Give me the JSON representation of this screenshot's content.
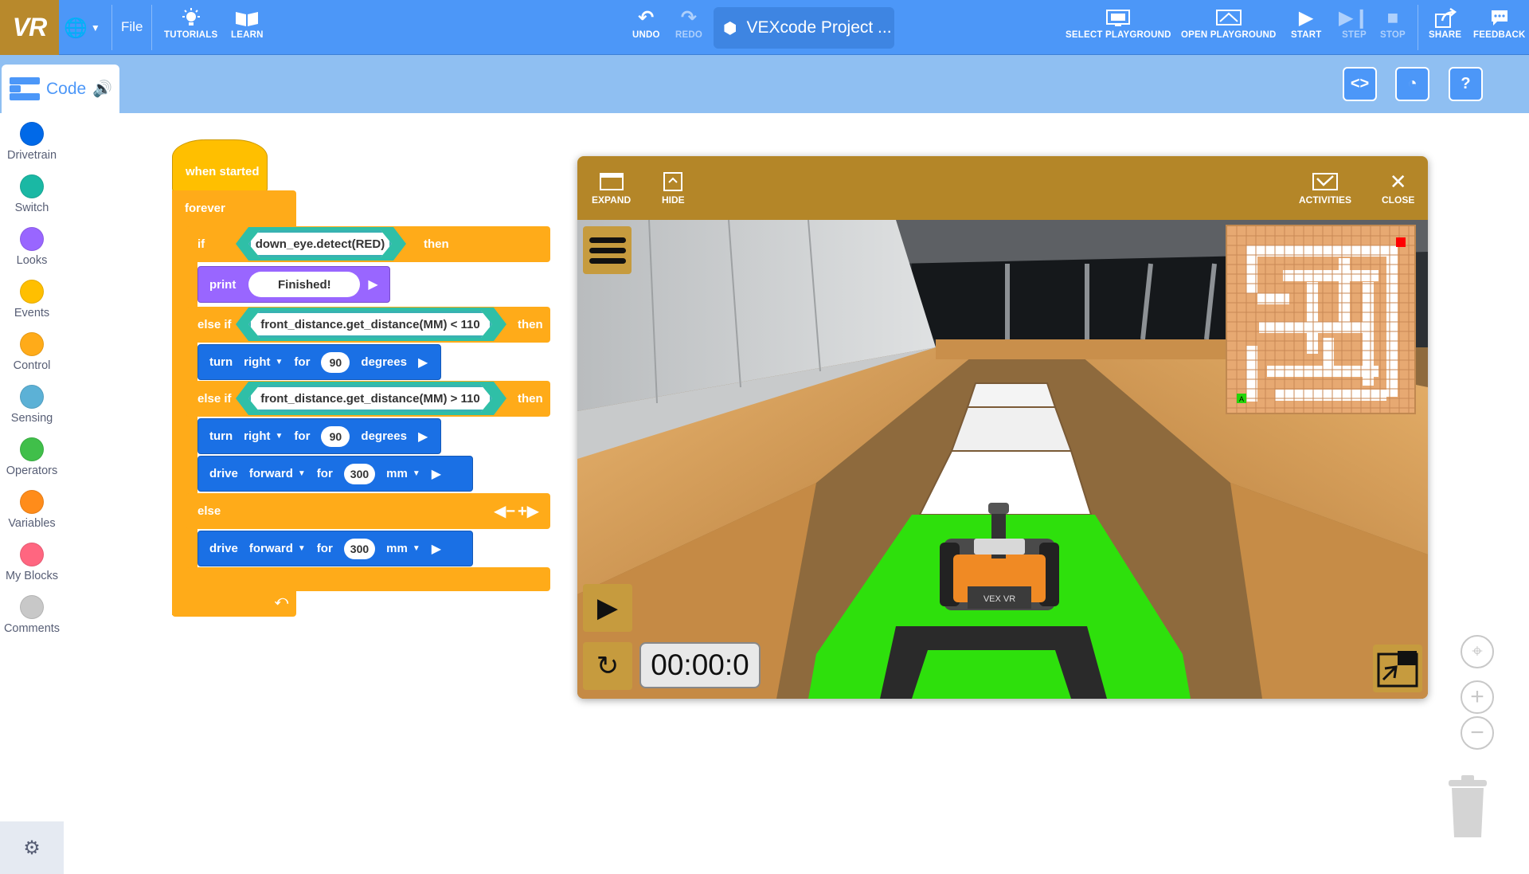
{
  "topbar": {
    "logo": "VR",
    "menu_file": "File",
    "tutorials": "TUTORIALS",
    "learn": "LEARN",
    "undo": "UNDO",
    "redo": "REDO",
    "project_name": "VEXcode Project ...",
    "select_playground": "SELECT PLAYGROUND",
    "open_playground": "OPEN PLAYGROUND",
    "start": "START",
    "step": "STEP",
    "stop": "STOP",
    "share": "SHARE",
    "feedback": "FEEDBACK"
  },
  "code_tab": {
    "label": "Code"
  },
  "categories": [
    {
      "label": "Drivetrain",
      "color": "#0069e8"
    },
    {
      "label": "Switch",
      "color": "#1ab8a4"
    },
    {
      "label": "Looks",
      "color": "#9966ff"
    },
    {
      "label": "Events",
      "color": "#ffbf00"
    },
    {
      "label": "Control",
      "color": "#ffab19"
    },
    {
      "label": "Sensing",
      "color": "#5cb1d6"
    },
    {
      "label": "Operators",
      "color": "#40bf4a"
    },
    {
      "label": "Variables",
      "color": "#ff8c1a"
    },
    {
      "label": "My Blocks",
      "color": "#ff6680"
    },
    {
      "label": "Comments",
      "color": "#c8c8c8"
    }
  ],
  "blocks": {
    "when_started": "when started",
    "forever": "forever",
    "if": "if",
    "cond1": "down_eye.detect(RED)",
    "then": "then",
    "print": "print",
    "print_text": "Finished!",
    "else_if": "else if",
    "cond2": "front_distance.get_distance(MM) < 110",
    "cond3": "front_distance.get_distance(MM) > 110",
    "turn": "turn",
    "right": "right",
    "for": "for",
    "turn_value": "90",
    "degrees": "degrees",
    "drive": "drive",
    "forward": "forward",
    "drive_value": "300",
    "mm": "mm",
    "else": "else"
  },
  "playground": {
    "expand": "EXPAND",
    "hide": "HIDE",
    "activities": "ACTIVITIES",
    "close": "CLOSE",
    "timer": "00:00:0",
    "robot_label": "VEX VR",
    "minimap_start": "A"
  }
}
